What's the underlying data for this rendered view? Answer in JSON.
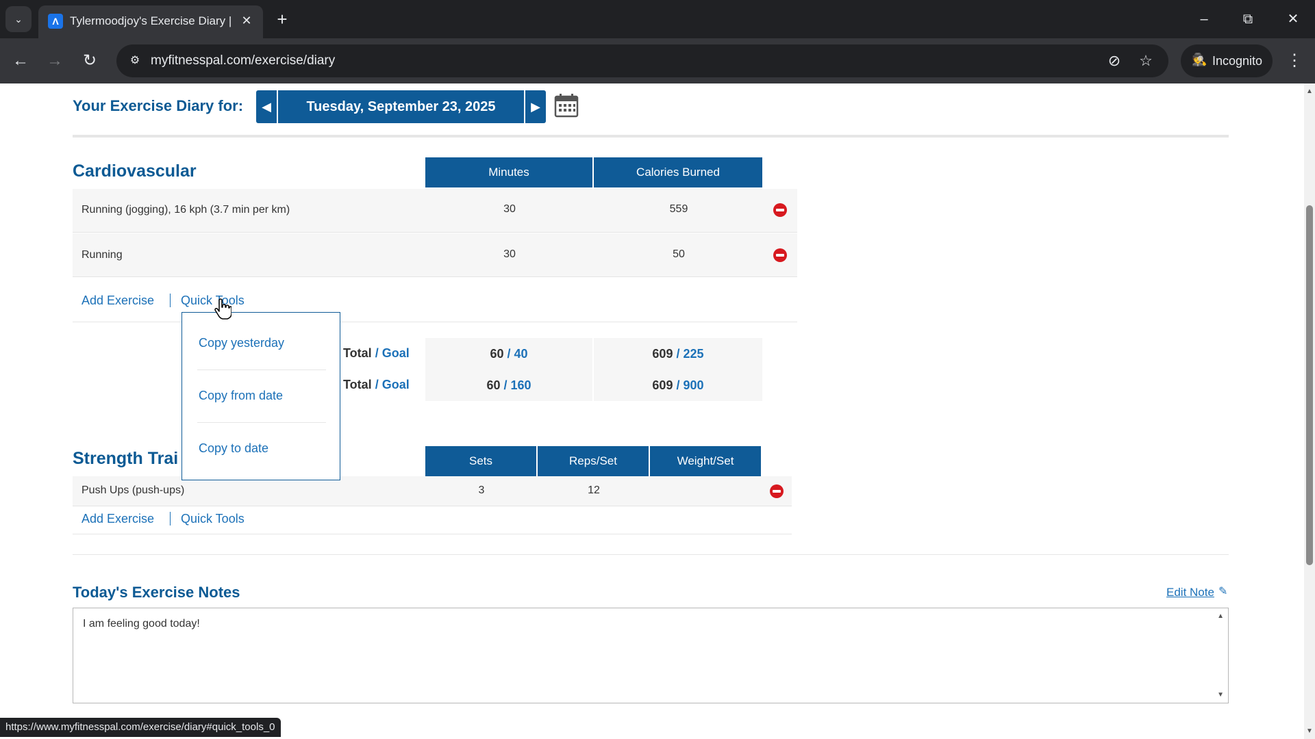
{
  "browser": {
    "tab_title": "Tylermoodjoy's Exercise Diary |",
    "url": "myfitnesspal.com/exercise/diary",
    "incognito_label": "Incognito",
    "status_url": "https://www.myfitnesspal.com/exercise/diary#quick_tools_0",
    "icons": {
      "tab_list": "chevron-down-icon",
      "favicon": "myfitnesspal-icon",
      "close": "close-icon",
      "new_tab": "plus-icon",
      "back": "arrow-left-icon",
      "forward": "arrow-right-icon",
      "reload": "reload-icon",
      "site_info": "tune-icon",
      "eye_off": "eye-off-icon",
      "bookmark": "star-icon",
      "menu": "kebab-menu-icon"
    }
  },
  "diary": {
    "label": "Your Exercise Diary for:",
    "date": "Tuesday, September 23, 2025"
  },
  "cardio": {
    "title": "Cardiovascular",
    "columns": [
      "Minutes",
      "Calories Burned"
    ],
    "rows": [
      {
        "name": "Running (jogging), 16 kph (3.7 min per km)",
        "minutes": "30",
        "calories": "559"
      },
      {
        "name": "Running",
        "minutes": "30",
        "calories": "50"
      }
    ],
    "add_exercise": "Add Exercise",
    "quick_tools": "Quick Tools"
  },
  "totals": [
    {
      "total_word": "Total",
      "slash": "/",
      "goal_word": "Goal",
      "minutes_total": "60",
      "minutes_goal": "40",
      "calories_total": "609",
      "calories_goal": "225"
    },
    {
      "total_word": "Total",
      "slash": "/",
      "goal_word": "Goal",
      "minutes_total": "60",
      "minutes_goal": "160",
      "calories_total": "609",
      "calories_goal": "900"
    }
  ],
  "quick_tools_menu": {
    "items": [
      "Copy yesterday",
      "Copy from date",
      "Copy to date"
    ]
  },
  "strength": {
    "title": "Strength Trai",
    "columns": [
      "Sets",
      "Reps/Set",
      "Weight/Set"
    ],
    "rows": [
      {
        "name": "Push Ups (push-ups)",
        "sets": "3",
        "reps": "12",
        "weight": ""
      }
    ],
    "add_exercise": "Add Exercise",
    "quick_tools": "Quick Tools"
  },
  "notes": {
    "title": "Today's Exercise Notes",
    "edit_label": "Edit Note",
    "text": "I am feeling good today!"
  },
  "colors": {
    "brand_blue": "#0f5b97",
    "link_blue": "#1c71b8",
    "delete_red": "#d7191f"
  }
}
